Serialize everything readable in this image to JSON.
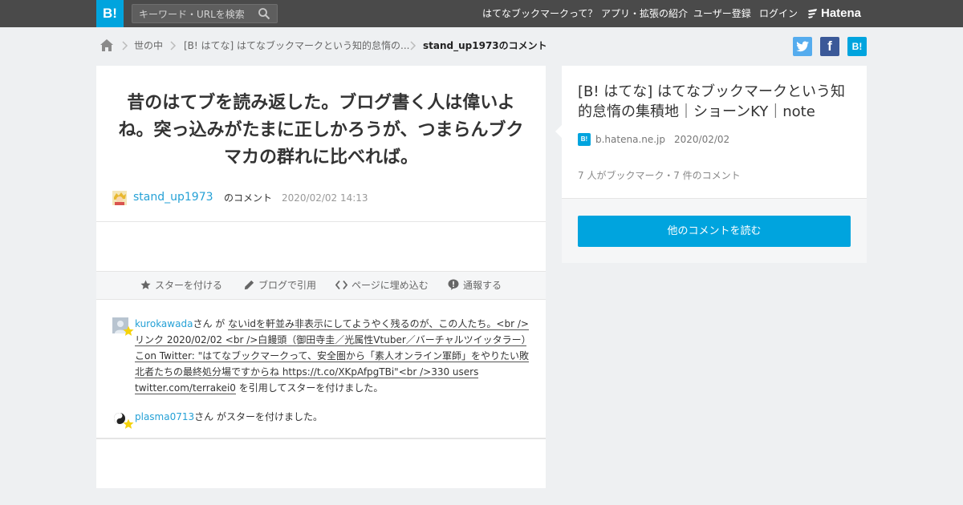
{
  "header": {
    "logo_text": "B!",
    "search_placeholder": "キーワード・URLを検索",
    "nav": [
      "はてなブックマークって？",
      "アプリ・拡張の紹介",
      "ユーザー登録",
      "ログイン"
    ],
    "brand": "Hatena"
  },
  "breadcrumb": {
    "items": [
      "世の中",
      "[B! はてな] はてなブックマークという知的怠惰の...",
      "stand_up1973のコメント"
    ]
  },
  "share": {
    "twitter": "t",
    "facebook": "f",
    "hatena": "B!"
  },
  "comment": {
    "text": "昔のはてブを読み返した。ブログ書く人は偉いよね。突っ込みがたまに正しかろうが、つまらんブクマカの群れに比べれば。",
    "username": "stand_up1973",
    "suffix": "のコメント",
    "date": "2020/02/02 14:13"
  },
  "actions": {
    "star": "スターを付ける",
    "blog": "ブログで引用",
    "embed": "ページに埋め込む",
    "report": "通報する"
  },
  "stars": [
    {
      "user": "kurokawada",
      "mid": "さん が ",
      "quote": "ないidを軒並み非表示にしてようやく残るのが、この人たち。<br />リンク 2020/02/02 <br />白饅頭（御田寺圭／光属性Vtuber／バーチャルツイッタラー）こon Twitter: \"はてなブックマークって、安全圏から「素人オンライン軍師」をやりたい敗北者たちの最終処分場ですからね https://t.co/XKpAfpgTBi\"<br />330 users twitter.com/terrakei0",
      "tail": " を引用してスターを付けました。"
    },
    {
      "user": "plasma0713",
      "mid": "さん がスターを付けました。"
    }
  ],
  "side": {
    "title": "[B! はてな] はてなブックマークという知的怠惰の集積地｜ショーンKY｜note",
    "site": "b.hatena.ne.jp",
    "date": "2020/02/02",
    "counts": "7 人がブックマーク・7 件のコメント",
    "read_button": "他のコメントを読む"
  },
  "colors": {
    "topbar": "#4a4a4a",
    "accent": "#00a4de",
    "link": "#25a1d6",
    "page_bg": "#eef0f2"
  }
}
